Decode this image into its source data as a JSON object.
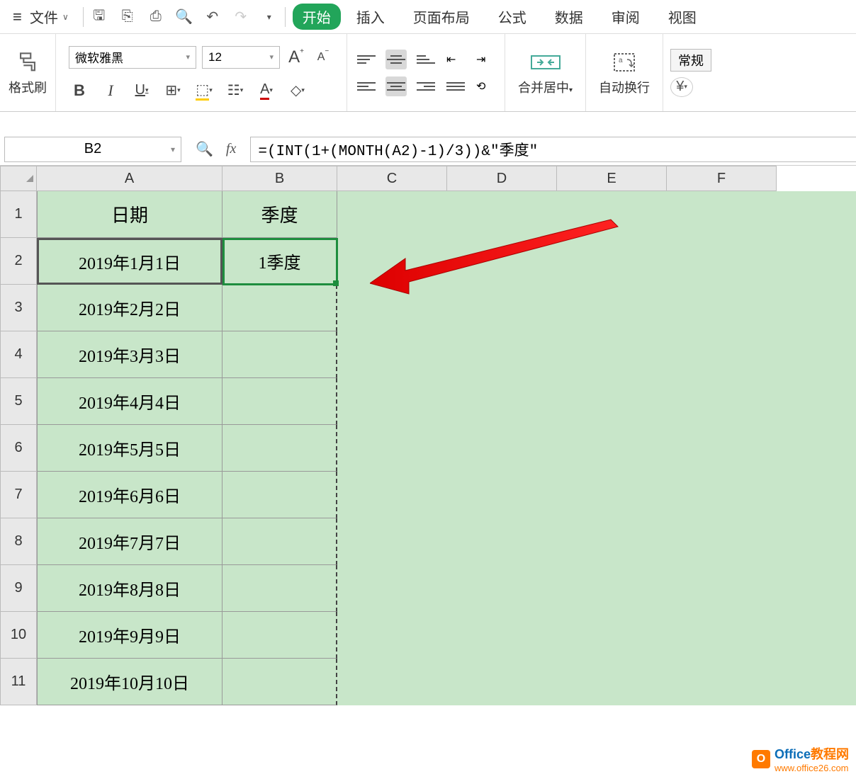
{
  "menubar": {
    "file_label": "文件",
    "tabs": [
      "开始",
      "插入",
      "页面布局",
      "公式",
      "数据",
      "审阅",
      "视图"
    ],
    "active_tab_index": 0
  },
  "ribbon": {
    "format_brush": "格式刷",
    "font_name": "微软雅黑",
    "font_size": "12",
    "merge_center": "合并居中",
    "wrap_text": "自动换行",
    "style_normal": "常规"
  },
  "formula_bar": {
    "name_box": "B2",
    "formula": "=(INT(1+(MONTH(A2)-1)/3))&\"季度\""
  },
  "sheet": {
    "columns": [
      "A",
      "B",
      "C",
      "D",
      "E",
      "F"
    ],
    "row_numbers": [
      "1",
      "2",
      "3",
      "4",
      "5",
      "6",
      "7",
      "8",
      "9",
      "10",
      "11"
    ],
    "headers": {
      "A": "日期",
      "B": "季度"
    },
    "data": [
      {
        "A": "2019年1月1日",
        "B": "1季度"
      },
      {
        "A": "2019年2月2日",
        "B": ""
      },
      {
        "A": "2019年3月3日",
        "B": ""
      },
      {
        "A": "2019年4月4日",
        "B": ""
      },
      {
        "A": "2019年5月5日",
        "B": ""
      },
      {
        "A": "2019年6月6日",
        "B": ""
      },
      {
        "A": "2019年7月7日",
        "B": ""
      },
      {
        "A": "2019年8月8日",
        "B": ""
      },
      {
        "A": "2019年9月9日",
        "B": ""
      },
      {
        "A": "2019年10月10日",
        "B": ""
      }
    ]
  },
  "watermark": {
    "text1": "Office",
    "text2": "教程网",
    "url": "www.office26.com"
  }
}
